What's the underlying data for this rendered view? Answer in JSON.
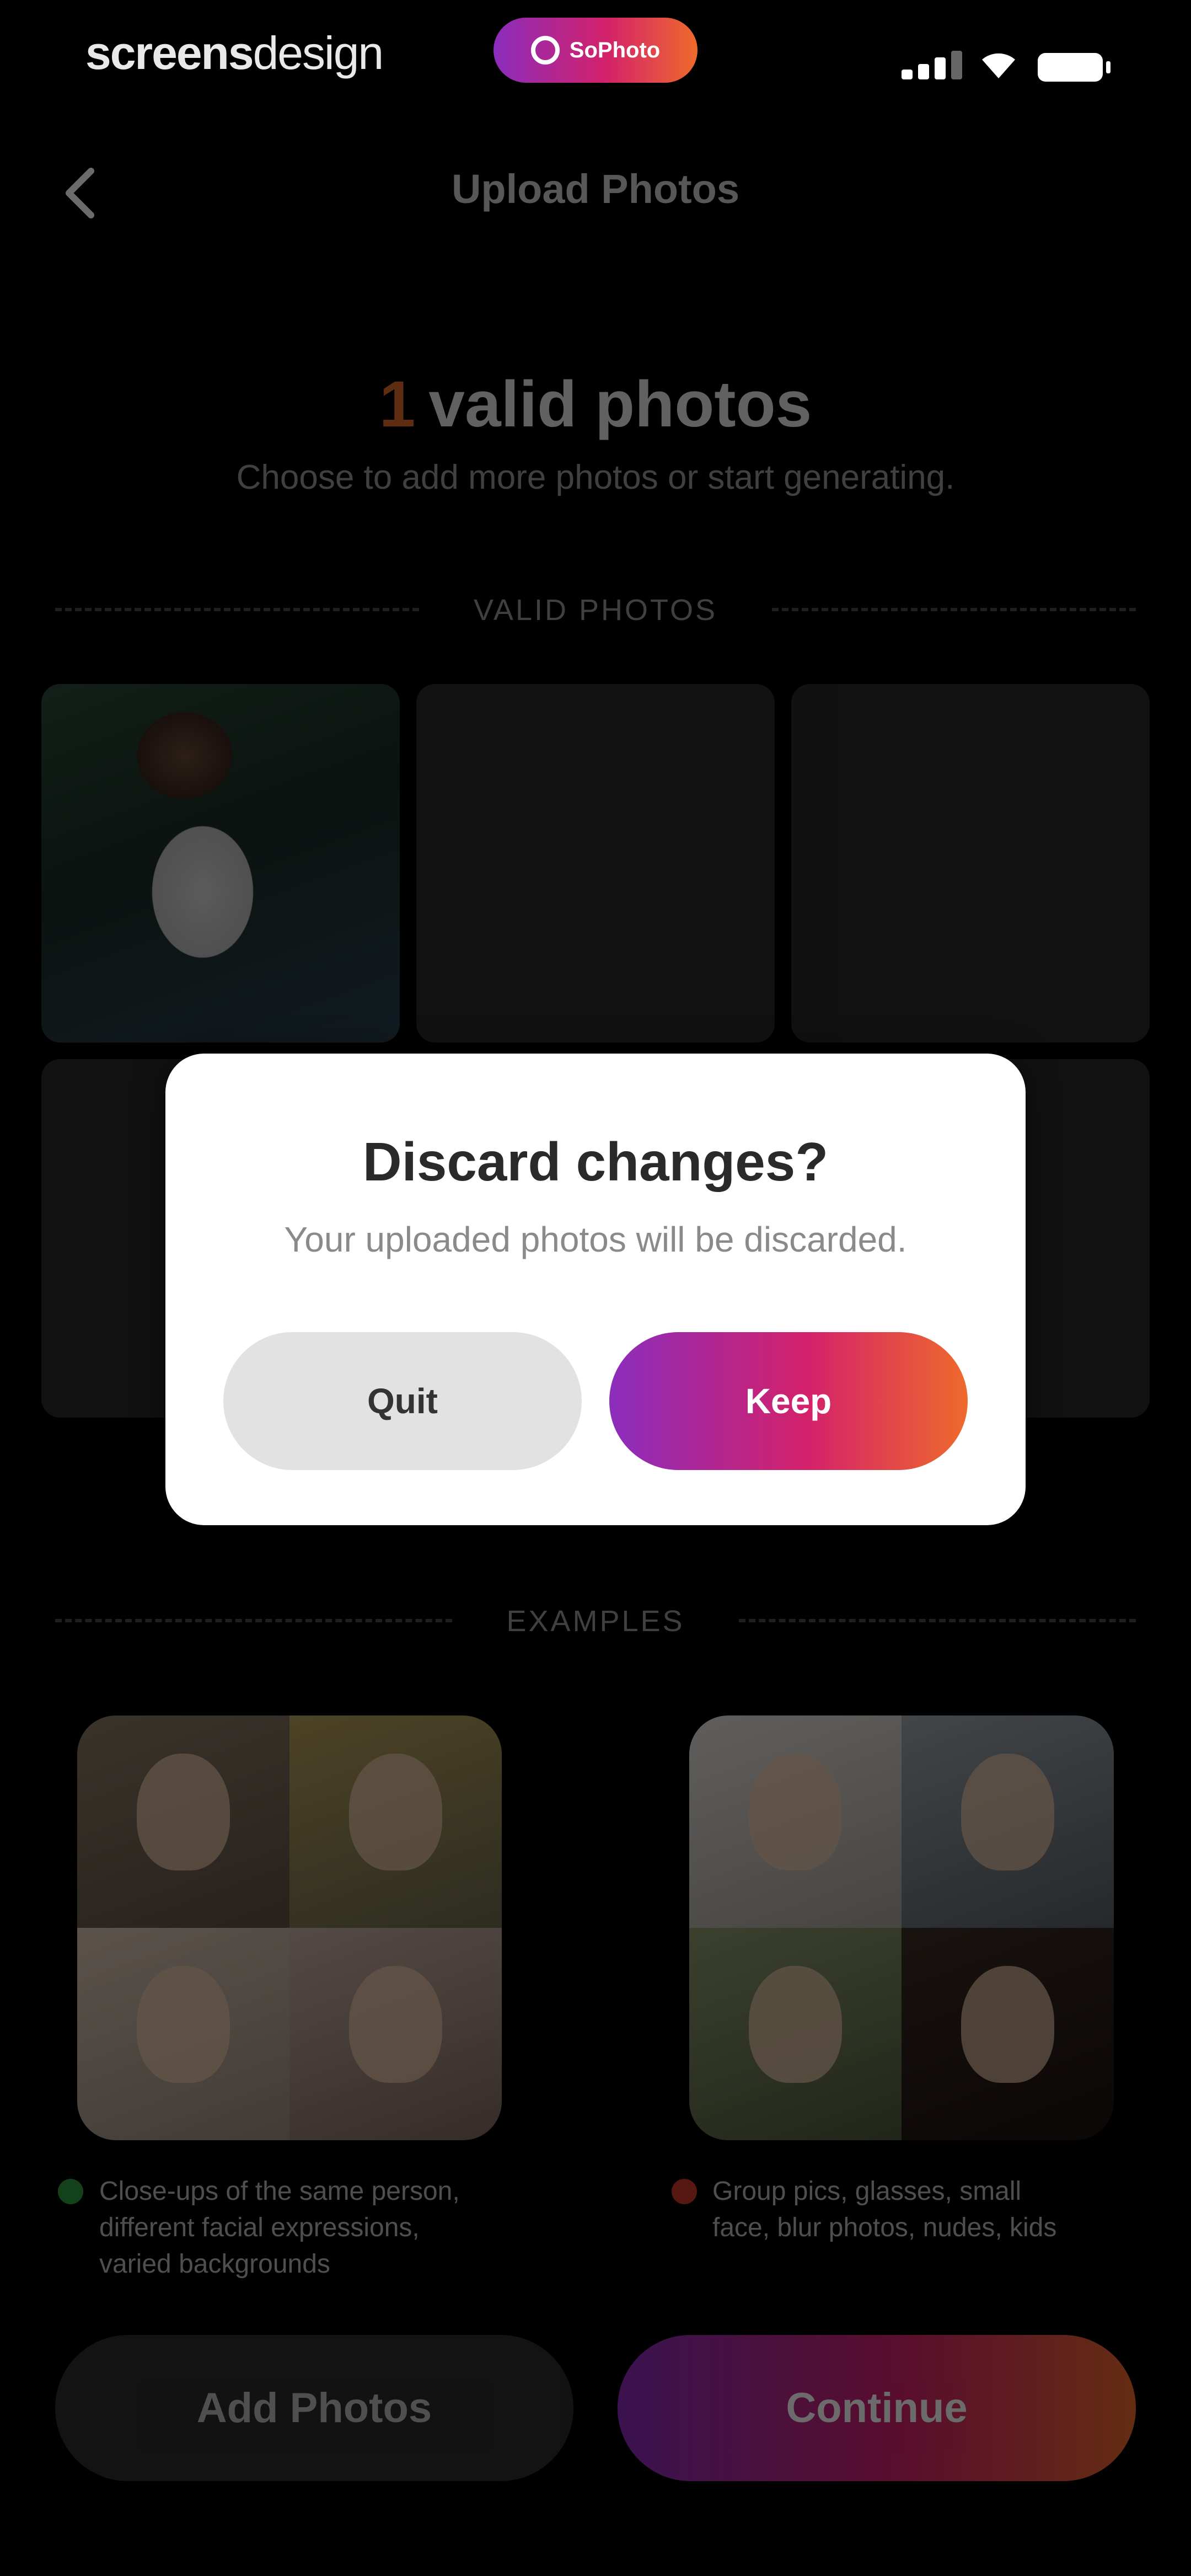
{
  "status_bar": {
    "brand_part1": "screens",
    "brand_part2": "design",
    "app_badge": "SoPhoto"
  },
  "header": {
    "title": "Upload Photos"
  },
  "summary": {
    "count": "1",
    "headline": "valid photos",
    "subtitle": "Choose to add more photos or start generating."
  },
  "valid_section": {
    "label": "VALID PHOTOS"
  },
  "examples_section": {
    "label": "EXAMPLES",
    "good_caption_line1": "Close-ups of the same person,",
    "good_caption_line2": "different facial expressions,",
    "good_caption_line3": "varied backgrounds",
    "bad_caption_line1": "Group pics, glasses, small",
    "bad_caption_line2": "face, blur photos, nudes, kids"
  },
  "actions": {
    "add_label": "Add Photos",
    "continue_label": "Continue"
  },
  "dialog": {
    "title": "Discard changes?",
    "message": "Your uploaded photos will be discarded.",
    "quit_label": "Quit",
    "keep_label": "Keep"
  },
  "colors": {
    "accent_start": "#8b2dbd",
    "accent_mid": "#d3216b",
    "accent_end": "#ef6a2c",
    "good_dot": "#2e9e3e",
    "bad_dot": "#d23a2a"
  }
}
